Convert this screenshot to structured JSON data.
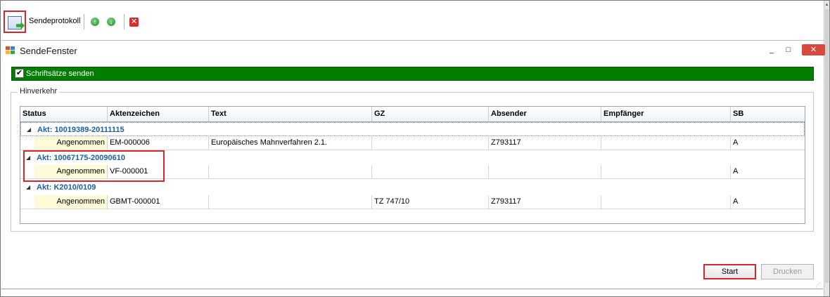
{
  "toolbar": {
    "label": "Sendeprotokoll"
  },
  "window": {
    "title": "SendeFenster",
    "min_glyph": "_",
    "max_glyph": "□",
    "close_glyph": "✕"
  },
  "send_checkbox": {
    "label": "Schriftsätze senden",
    "checked": true
  },
  "group_label": "Hinverkehr",
  "grid": {
    "columns": [
      "Status",
      "Aktenzeichen",
      "Text",
      "GZ",
      "Absender",
      "Empfänger",
      "SB"
    ],
    "groups": [
      {
        "title": "Akt: 10019389-20111115",
        "rows": [
          {
            "status": "Angenommen",
            "aktenzeichen": "EM-000006",
            "text": "Europäisches Mahnverfahren 2.1.",
            "gz": "",
            "absender": "Z793117",
            "empfaenger": "",
            "sb": "A"
          }
        ]
      },
      {
        "title": "Akt: 10067175-20090610",
        "rows": [
          {
            "status": "Angenommen",
            "aktenzeichen": "VF-000001",
            "text": "",
            "gz": "",
            "absender": "",
            "empfaenger": "",
            "sb": "A"
          }
        ]
      },
      {
        "title": "Akt: K2010/0109",
        "rows": [
          {
            "status": "Angenommen",
            "aktenzeichen": "GBMT-000001",
            "text": "",
            "gz": "TZ 747/10",
            "absender": "Z793117",
            "empfaenger": "",
            "sb": "A"
          }
        ]
      }
    ]
  },
  "buttons": {
    "start": "Start",
    "print": "Drucken"
  },
  "colors": {
    "highlight_red": "#d8262a",
    "group_title_blue": "#1a5fa8",
    "green_bar": "#007e00"
  }
}
